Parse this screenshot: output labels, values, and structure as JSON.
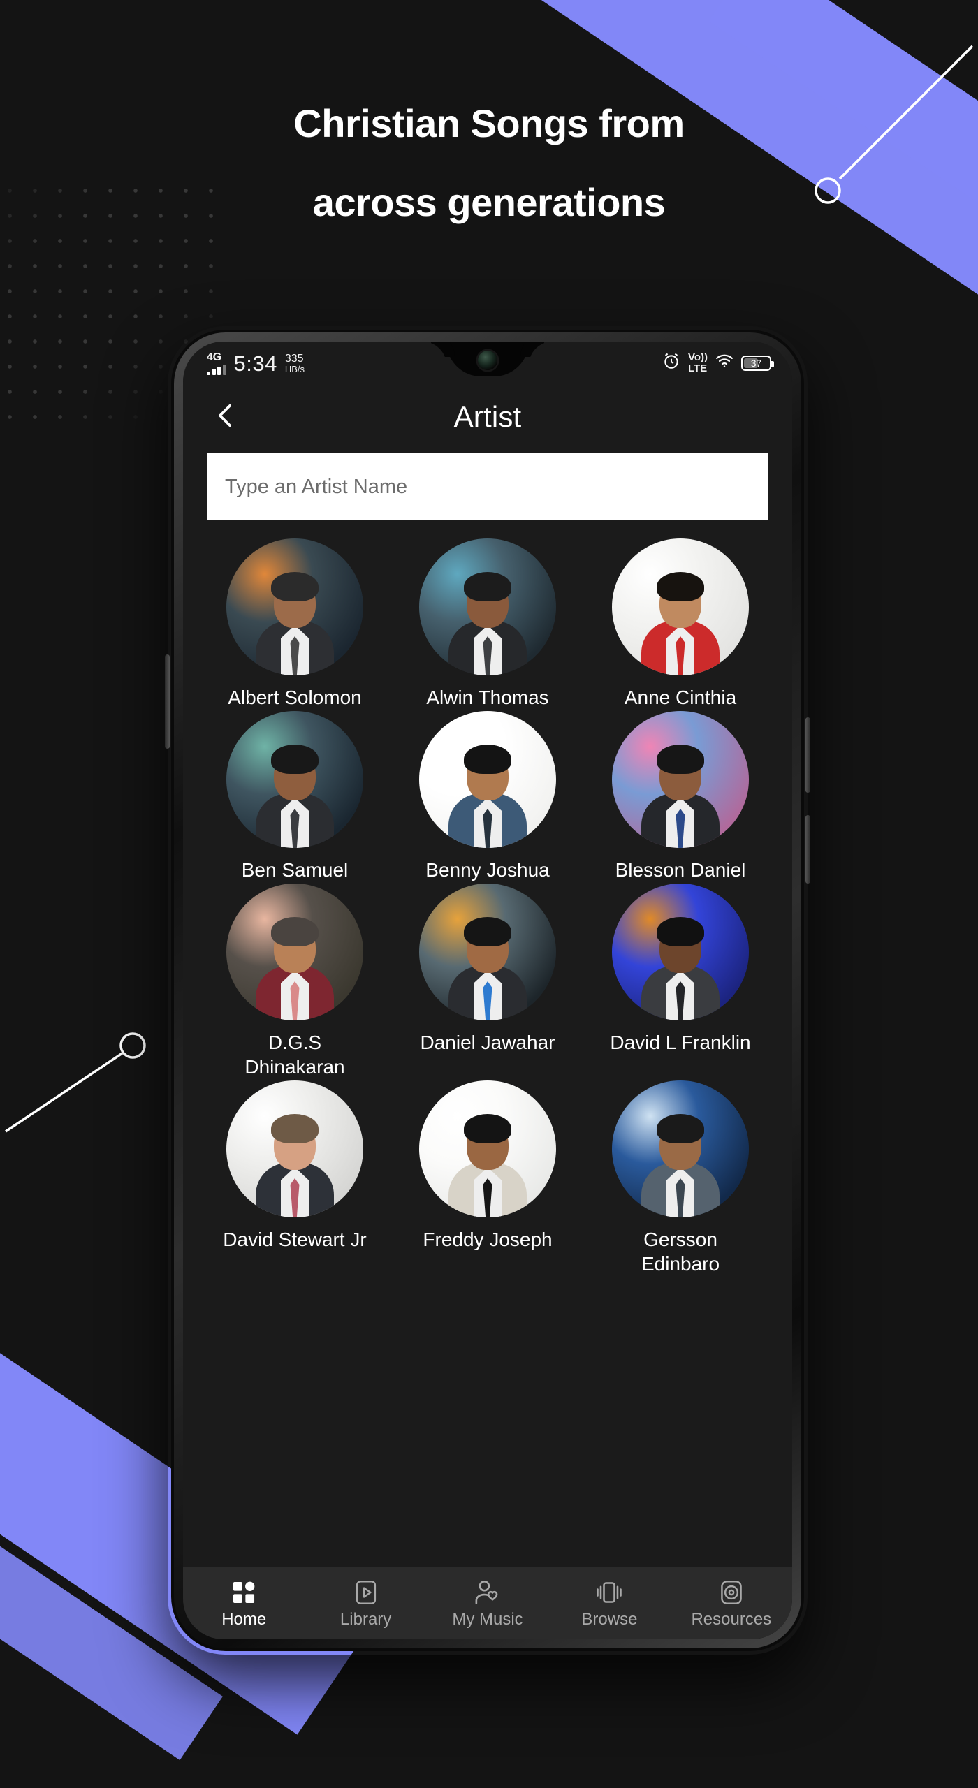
{
  "theme": {
    "accent": "#8287f7",
    "page_bg": "#141414",
    "app_bg": "#1b1b1b",
    "tabbar_bg": "#2b2b2b",
    "text_primary": "#ffffff",
    "text_muted": "#a9a9a9",
    "search_bg": "#ffffff",
    "search_text": "#6c6c6c"
  },
  "headline": {
    "line1": "Christian Songs from",
    "line2": "across generations"
  },
  "statusbar": {
    "network_type": "4G",
    "time": "5:34",
    "net_speed_value": "335",
    "net_speed_unit": "HB/s",
    "alarm_icon": "alarm-clock-icon",
    "volte_top": "Vo))",
    "volte_bottom": "LTE",
    "wifi_icon": "wifi-icon",
    "battery_percent": "37"
  },
  "appbar": {
    "back_icon": "chevron-left-icon",
    "title": "Artist"
  },
  "search": {
    "placeholder": "Type an Artist Name",
    "value": ""
  },
  "artists": [
    {
      "name": "Albert Solomon",
      "bg": "#1b2630",
      "bg2": "#3a4a52",
      "skin": "#9c6b4a",
      "hair": "#2b2b2b",
      "suit": "#2d2f33",
      "tie": "#4a4a4a",
      "accent_light": "#e0873a"
    },
    {
      "name": "Alwin Thomas",
      "bg": "#1f2a31",
      "bg2": "#46606d",
      "skin": "#8a5a3c",
      "hair": "#1c1c1c",
      "suit": "#26282b",
      "tie": "#3d3f42",
      "accent_light": "#5fa8bf"
    },
    {
      "name": "Anne Cinthia",
      "bg": "#e4e4e2",
      "bg2": "#f3f3f1",
      "skin": "#c08a60",
      "hair": "#17130f",
      "suit": "#cc2b2b",
      "tie": "#cc2b2b",
      "accent_light": "#ffffff"
    },
    {
      "name": "Ben Samuel",
      "bg": "#1a2630",
      "bg2": "#3f5560",
      "skin": "#8f5e3e",
      "hair": "#181818",
      "suit": "#2b2d31",
      "tie": "#3a3c40",
      "accent_light": "#6fb3a6"
    },
    {
      "name": "Benny Joshua",
      "bg": "#f2f2f0",
      "bg2": "#ffffff",
      "skin": "#b07a4f",
      "hair": "#141414",
      "suit": "#3d5a77",
      "tie": "#26323d",
      "accent_light": "#ffffff"
    },
    {
      "name": "Blesson Daniel",
      "bg": "#b06a9c",
      "bg2": "#7a9bd4",
      "skin": "#8c5c3d",
      "hair": "#161616",
      "suit": "#25272b",
      "tie": "#2c4a8a",
      "accent_light": "#ef85b5"
    },
    {
      "name": "D.G.S Dhinakaran",
      "bg": "#3b382f",
      "bg2": "#56504a",
      "skin": "#b98157",
      "hair": "#4a4440",
      "suit": "#7e2630",
      "tie": "#d98a8a",
      "accent_light": "#e8b6a0"
    },
    {
      "name": "Daniel Jawahar",
      "bg": "#1d252a",
      "bg2": "#586a72",
      "skin": "#a06a44",
      "hair": "#151515",
      "suit": "#2a2c30",
      "tie": "#2d7ad0",
      "accent_light": "#e6a23c"
    },
    {
      "name": "David L Franklin",
      "bg": "#1c2480",
      "bg2": "#3344d8",
      "skin": "#6d452c",
      "hair": "#111111",
      "suit": "#3a3c40",
      "tie": "#232428",
      "accent_light": "#e08a28"
    },
    {
      "name": "David Stewart Jr",
      "bg": "#d6d6d4",
      "bg2": "#eeeeec",
      "skin": "#d6a183",
      "hair": "#6e5a46",
      "suit": "#2d3138",
      "tie": "#b85a6a",
      "accent_light": "#ffffff"
    },
    {
      "name": "Freddy Joseph",
      "bg": "#e9eae8",
      "bg2": "#fbfbfa",
      "skin": "#9a6742",
      "hair": "#141414",
      "suit": "#d8d3c8",
      "tie": "#161616",
      "accent_light": "#ffffff"
    },
    {
      "name": "Gersson Edinbaro",
      "bg": "#12294a",
      "bg2": "#2a5a9c",
      "skin": "#9a6a46",
      "hair": "#1a1a1a",
      "suit": "#55626e",
      "tie": "#3b4650",
      "accent_light": "#cfe2f2"
    }
  ],
  "tabbar": {
    "items": [
      {
        "label": "Home",
        "icon": "grid-dashboard-icon",
        "active": true
      },
      {
        "label": "Library",
        "icon": "play-rect-icon",
        "active": false
      },
      {
        "label": "My Music",
        "icon": "person-heart-icon",
        "active": false
      },
      {
        "label": "Browse",
        "icon": "card-stack-icon",
        "active": false
      },
      {
        "label": "Resources",
        "icon": "disc-record-icon",
        "active": false
      }
    ]
  },
  "decorations": {
    "circle_line_top_right": "circle-line-decoration",
    "circle_line_bottom_left": "circle-line-decoration",
    "dot_grid": "dot-grid-pattern",
    "stripes": "diagonal-stripes"
  }
}
